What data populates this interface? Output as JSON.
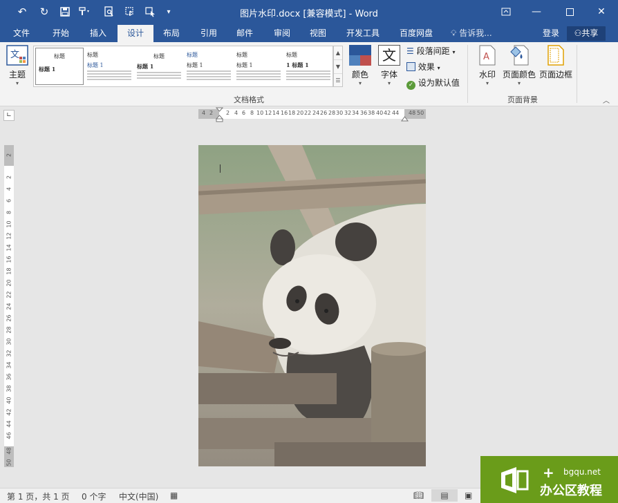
{
  "titlebar": {
    "title": "图片水印.docx [兼容模式] - Word",
    "quick_access": [
      "undo-icon",
      "redo-icon",
      "save-icon",
      "format-painter-icon",
      "print-preview-icon",
      "touch-mode-icon",
      "selection-icon",
      "customize-icon"
    ],
    "window_controls": [
      "ribbon-display-icon",
      "minimize-icon",
      "maximize-icon",
      "close-icon"
    ]
  },
  "tabs": [
    "文件",
    "开始",
    "插入",
    "设计",
    "布局",
    "引用",
    "邮件",
    "审阅",
    "视图",
    "开发工具",
    "百度网盘"
  ],
  "active_tab": "设计",
  "tell_me": "告诉我...",
  "login": "登录",
  "share": "共享",
  "ribbon": {
    "theme_label": "主题",
    "gallery": {
      "items": [
        {
          "title": "标题",
          "sub": "标题 1"
        },
        {
          "title": "标题",
          "sub": "标题 1"
        },
        {
          "title": "标题",
          "sub": "标题 1"
        },
        {
          "title": "标题",
          "sub": "标题 1"
        },
        {
          "title": "标题",
          "sub": "标题 1"
        },
        {
          "title": "标题",
          "sub": "1 标题 1"
        }
      ]
    },
    "colors_label": "颜色",
    "fonts_label": "字体",
    "fonts_glyph": "文",
    "paragraph_spacing_label": "段落间距",
    "effects_label": "效果",
    "set_default_label": "设为默认值",
    "group_document_format": "文档格式",
    "watermark_label": "水印",
    "page_color_label": "页面颜色",
    "page_borders_label": "页面边框",
    "group_page_background": "页面背景"
  },
  "ruler": {
    "horizontal": [
      "4",
      "2",
      "2",
      "4",
      "6",
      "8",
      "10",
      "12",
      "14",
      "16",
      "18",
      "20",
      "22",
      "24",
      "26",
      "28",
      "30",
      "32",
      "34",
      "36",
      "38",
      "40",
      "42",
      "44",
      "48",
      "50"
    ],
    "vertical": [
      "2",
      "2",
      "4",
      "6",
      "8",
      "10",
      "12",
      "14",
      "16",
      "18",
      "20",
      "22",
      "24",
      "26",
      "28",
      "30",
      "32",
      "34",
      "36",
      "38",
      "40",
      "42",
      "44",
      "46",
      "48",
      "50"
    ]
  },
  "status": {
    "page": "第 1 页，共 1 页",
    "words": "0 个字",
    "language": "中文(中国)"
  },
  "badge": {
    "url": "bgqu.net",
    "name": "办公区教程"
  },
  "colors": {
    "accent": "#2b579a",
    "badge": "#6a9c1a"
  }
}
